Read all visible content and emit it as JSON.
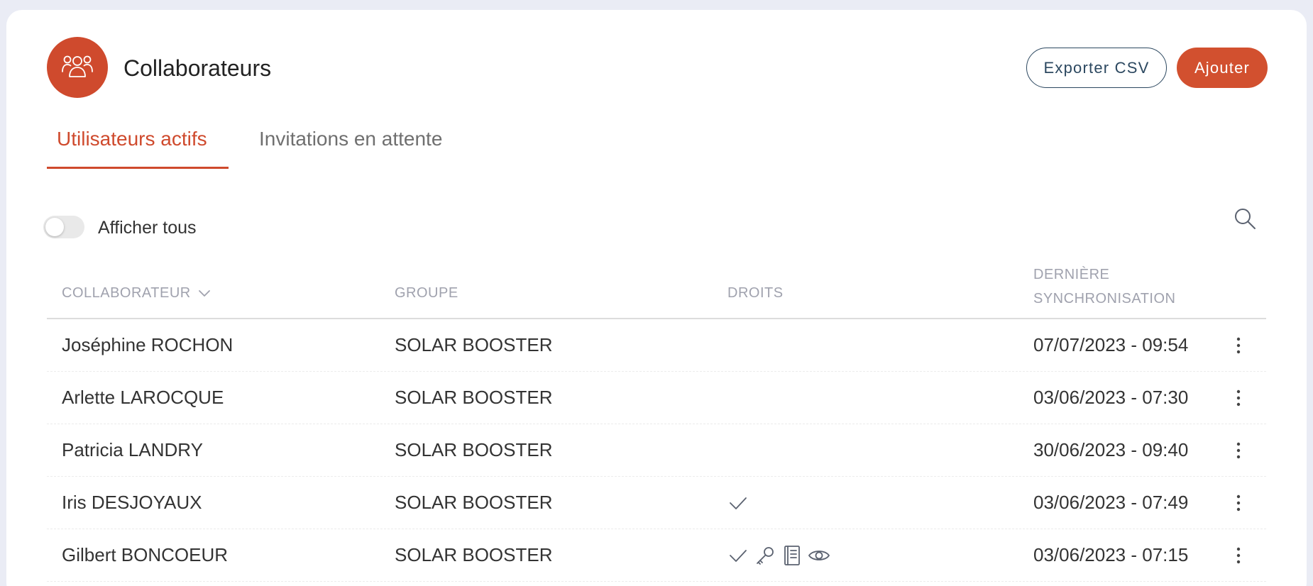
{
  "header": {
    "icon": "users-icon",
    "title": "Collaborateurs",
    "export_label": "Exporter CSV",
    "add_label": "Ajouter"
  },
  "tabs": [
    {
      "label": "Utilisateurs actifs",
      "active": true
    },
    {
      "label": "Invitations en attente",
      "active": false
    }
  ],
  "filters": {
    "show_all_label": "Afficher tous",
    "show_all_on": false,
    "search_icon": "search-icon"
  },
  "table": {
    "columns": [
      {
        "label": "COLLABORATEUR",
        "sortable": true
      },
      {
        "label": "GROUPE"
      },
      {
        "label": "DROITS"
      },
      {
        "label": "DERNIÈRE SYNCHRONISATION",
        "line1": "DERNIÈRE",
        "line2": "SYNCHRONISATION"
      }
    ],
    "rows": [
      {
        "name": "Joséphine ROCHON",
        "group": "SOLAR BOOSTER",
        "rights": [],
        "last_sync": "07/07/2023 - 09:54"
      },
      {
        "name": "Arlette LAROCQUE",
        "group": "SOLAR BOOSTER",
        "rights": [],
        "last_sync": "03/06/2023 - 07:30"
      },
      {
        "name": "Patricia LANDRY",
        "group": "SOLAR BOOSTER",
        "rights": [],
        "last_sync": "30/06/2023 - 09:40"
      },
      {
        "name": "Iris DESJOYAUX",
        "group": "SOLAR BOOSTER",
        "rights": [
          "check-icon"
        ],
        "last_sync": "03/06/2023 - 07:49"
      },
      {
        "name": "Gilbert BONCOEUR",
        "group": "SOLAR BOOSTER",
        "rights": [
          "check-icon",
          "key-icon",
          "book-icon",
          "eye-icon"
        ],
        "last_sync": "03/06/2023 - 07:15"
      }
    ]
  },
  "colors": {
    "accent": "#cf4a2d",
    "button_primary": "#d2502f",
    "button_outline": "#2c4860",
    "header_text": "#a0a2ae",
    "background": "#eaecf5"
  }
}
